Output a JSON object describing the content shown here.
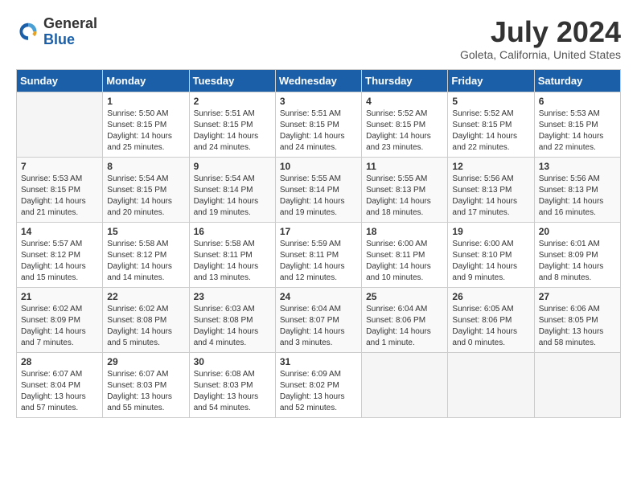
{
  "header": {
    "logo_general": "General",
    "logo_blue": "Blue",
    "month_year": "July 2024",
    "location": "Goleta, California, United States"
  },
  "days_of_week": [
    "Sunday",
    "Monday",
    "Tuesday",
    "Wednesday",
    "Thursday",
    "Friday",
    "Saturday"
  ],
  "weeks": [
    [
      {
        "day": "",
        "content": ""
      },
      {
        "day": "1",
        "content": "Sunrise: 5:50 AM\nSunset: 8:15 PM\nDaylight: 14 hours\nand 25 minutes."
      },
      {
        "day": "2",
        "content": "Sunrise: 5:51 AM\nSunset: 8:15 PM\nDaylight: 14 hours\nand 24 minutes."
      },
      {
        "day": "3",
        "content": "Sunrise: 5:51 AM\nSunset: 8:15 PM\nDaylight: 14 hours\nand 24 minutes."
      },
      {
        "day": "4",
        "content": "Sunrise: 5:52 AM\nSunset: 8:15 PM\nDaylight: 14 hours\nand 23 minutes."
      },
      {
        "day": "5",
        "content": "Sunrise: 5:52 AM\nSunset: 8:15 PM\nDaylight: 14 hours\nand 22 minutes."
      },
      {
        "day": "6",
        "content": "Sunrise: 5:53 AM\nSunset: 8:15 PM\nDaylight: 14 hours\nand 22 minutes."
      }
    ],
    [
      {
        "day": "7",
        "content": "Sunrise: 5:53 AM\nSunset: 8:15 PM\nDaylight: 14 hours\nand 21 minutes."
      },
      {
        "day": "8",
        "content": "Sunrise: 5:54 AM\nSunset: 8:15 PM\nDaylight: 14 hours\nand 20 minutes."
      },
      {
        "day": "9",
        "content": "Sunrise: 5:54 AM\nSunset: 8:14 PM\nDaylight: 14 hours\nand 19 minutes."
      },
      {
        "day": "10",
        "content": "Sunrise: 5:55 AM\nSunset: 8:14 PM\nDaylight: 14 hours\nand 19 minutes."
      },
      {
        "day": "11",
        "content": "Sunrise: 5:55 AM\nSunset: 8:13 PM\nDaylight: 14 hours\nand 18 minutes."
      },
      {
        "day": "12",
        "content": "Sunrise: 5:56 AM\nSunset: 8:13 PM\nDaylight: 14 hours\nand 17 minutes."
      },
      {
        "day": "13",
        "content": "Sunrise: 5:56 AM\nSunset: 8:13 PM\nDaylight: 14 hours\nand 16 minutes."
      }
    ],
    [
      {
        "day": "14",
        "content": "Sunrise: 5:57 AM\nSunset: 8:12 PM\nDaylight: 14 hours\nand 15 minutes."
      },
      {
        "day": "15",
        "content": "Sunrise: 5:58 AM\nSunset: 8:12 PM\nDaylight: 14 hours\nand 14 minutes."
      },
      {
        "day": "16",
        "content": "Sunrise: 5:58 AM\nSunset: 8:11 PM\nDaylight: 14 hours\nand 13 minutes."
      },
      {
        "day": "17",
        "content": "Sunrise: 5:59 AM\nSunset: 8:11 PM\nDaylight: 14 hours\nand 12 minutes."
      },
      {
        "day": "18",
        "content": "Sunrise: 6:00 AM\nSunset: 8:11 PM\nDaylight: 14 hours\nand 10 minutes."
      },
      {
        "day": "19",
        "content": "Sunrise: 6:00 AM\nSunset: 8:10 PM\nDaylight: 14 hours\nand 9 minutes."
      },
      {
        "day": "20",
        "content": "Sunrise: 6:01 AM\nSunset: 8:09 PM\nDaylight: 14 hours\nand 8 minutes."
      }
    ],
    [
      {
        "day": "21",
        "content": "Sunrise: 6:02 AM\nSunset: 8:09 PM\nDaylight: 14 hours\nand 7 minutes."
      },
      {
        "day": "22",
        "content": "Sunrise: 6:02 AM\nSunset: 8:08 PM\nDaylight: 14 hours\nand 5 minutes."
      },
      {
        "day": "23",
        "content": "Sunrise: 6:03 AM\nSunset: 8:08 PM\nDaylight: 14 hours\nand 4 minutes."
      },
      {
        "day": "24",
        "content": "Sunrise: 6:04 AM\nSunset: 8:07 PM\nDaylight: 14 hours\nand 3 minutes."
      },
      {
        "day": "25",
        "content": "Sunrise: 6:04 AM\nSunset: 8:06 PM\nDaylight: 14 hours\nand 1 minute."
      },
      {
        "day": "26",
        "content": "Sunrise: 6:05 AM\nSunset: 8:06 PM\nDaylight: 14 hours\nand 0 minutes."
      },
      {
        "day": "27",
        "content": "Sunrise: 6:06 AM\nSunset: 8:05 PM\nDaylight: 13 hours\nand 58 minutes."
      }
    ],
    [
      {
        "day": "28",
        "content": "Sunrise: 6:07 AM\nSunset: 8:04 PM\nDaylight: 13 hours\nand 57 minutes."
      },
      {
        "day": "29",
        "content": "Sunrise: 6:07 AM\nSunset: 8:03 PM\nDaylight: 13 hours\nand 55 minutes."
      },
      {
        "day": "30",
        "content": "Sunrise: 6:08 AM\nSunset: 8:03 PM\nDaylight: 13 hours\nand 54 minutes."
      },
      {
        "day": "31",
        "content": "Sunrise: 6:09 AM\nSunset: 8:02 PM\nDaylight: 13 hours\nand 52 minutes."
      },
      {
        "day": "",
        "content": ""
      },
      {
        "day": "",
        "content": ""
      },
      {
        "day": "",
        "content": ""
      }
    ]
  ]
}
